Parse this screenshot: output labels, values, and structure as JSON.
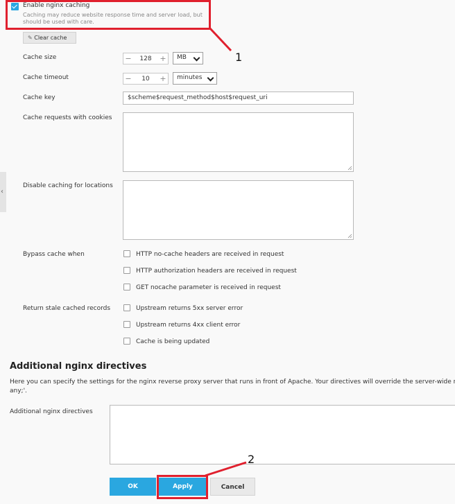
{
  "caching": {
    "enable_label": "Enable nginx caching",
    "enable_checked": true,
    "hint": "Caching may reduce website response time and server load, but should be used with care.",
    "clear_cache_label": "Clear cache"
  },
  "fields": {
    "cache_size_label": "Cache size",
    "cache_size_value": "128",
    "cache_size_unit": "MB",
    "cache_timeout_label": "Cache timeout",
    "cache_timeout_value": "10",
    "cache_timeout_unit": "minutes",
    "cache_key_label": "Cache key",
    "cache_key_value": "$scheme$request_method$host$request_uri",
    "cookies_label": "Cache requests with cookies",
    "disable_locations_label": "Disable caching for locations"
  },
  "bypass": {
    "label": "Bypass cache when",
    "options": [
      "HTTP no-cache headers are received in request",
      "HTTP authorization headers are received in request",
      "GET nocache parameter is received in request"
    ]
  },
  "stale": {
    "label": "Return stale cached records",
    "options": [
      "Upstream returns 5xx server error",
      "Upstream returns 4xx client error",
      "Cache is being updated"
    ]
  },
  "directives": {
    "heading": "Additional nginx directives",
    "description": "Here you can specify the settings for the nginx reverse proxy server that runs in front of Apache. Your directives will override the server-wide nginx c",
    "description_line2": "any;'.",
    "field_label": "Additional nginx directives"
  },
  "buttons": {
    "ok": "OK",
    "apply": "Apply",
    "cancel": "Cancel"
  },
  "annotations": {
    "marker1": "1",
    "marker2": "2"
  },
  "colors": {
    "accent": "#2aa7e0",
    "annotation_red": "#e0202e"
  }
}
